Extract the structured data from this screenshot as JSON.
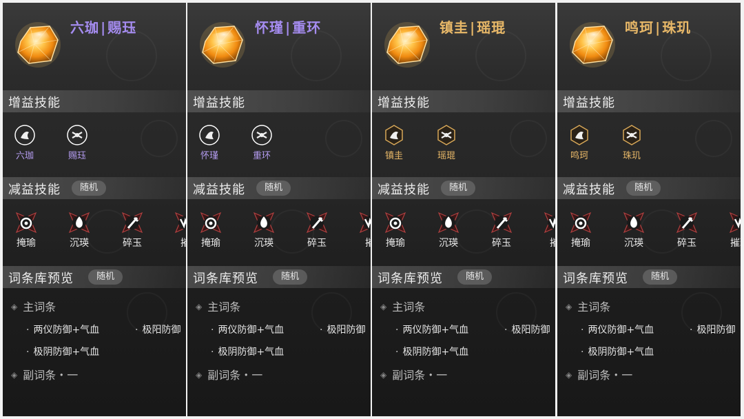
{
  "colors": {
    "purple_title": "#a58cf0",
    "gold_title": "#e8b868",
    "purple_label": "#b49cf0",
    "gold_label": "#e8b868"
  },
  "sections": {
    "buff": "增益技能",
    "debuff": "减益技能",
    "random": "随机",
    "affix": "词条库预览",
    "main_affix": "主词条",
    "sub_affix": "副词条・一"
  },
  "debuffs": [
    {
      "label": "掩瑜",
      "icon": "swirl-eye-icon"
    },
    {
      "label": "沉瑛",
      "icon": "flame-drop-icon"
    },
    {
      "label": "碎玉",
      "icon": "broken-sword-icon"
    },
    {
      "label": "摧",
      "icon": "beast-claw-icon"
    }
  ],
  "affixes": {
    "a": "两仪防御+气血",
    "b": "极阳防御",
    "c": "极阴防御+气血"
  },
  "panels": [
    {
      "title_a": "六珈",
      "title_b": "赐珏",
      "theme": "purple",
      "buffs": [
        {
          "label": "六珈",
          "icon": "wing-blade-icon"
        },
        {
          "label": "赐珏",
          "icon": "flame-ring-icon"
        }
      ],
      "debuff4": "摧"
    },
    {
      "title_a": "怀瑾",
      "title_b": "重环",
      "theme": "purple",
      "buffs": [
        {
          "label": "怀瑾",
          "icon": "shield-orb-icon"
        },
        {
          "label": "重环",
          "icon": "crossed-swords-icon"
        }
      ],
      "debuff4": "摧"
    },
    {
      "title_a": "镇圭",
      "title_b": "瑶琨",
      "theme": "gold",
      "buffs": [
        {
          "label": "镇圭",
          "icon": "hex-gem-icon"
        },
        {
          "label": "瑶琨",
          "icon": "winged-crest-icon"
        }
      ],
      "debuff4": "摧"
    },
    {
      "title_a": "鸣珂",
      "title_b": "珠玑",
      "theme": "gold",
      "buffs": [
        {
          "label": "鸣珂",
          "icon": "twin-blade-icon"
        },
        {
          "label": "珠玑",
          "icon": "slash-mark-icon"
        }
      ],
      "debuff4": "摧珠"
    }
  ]
}
